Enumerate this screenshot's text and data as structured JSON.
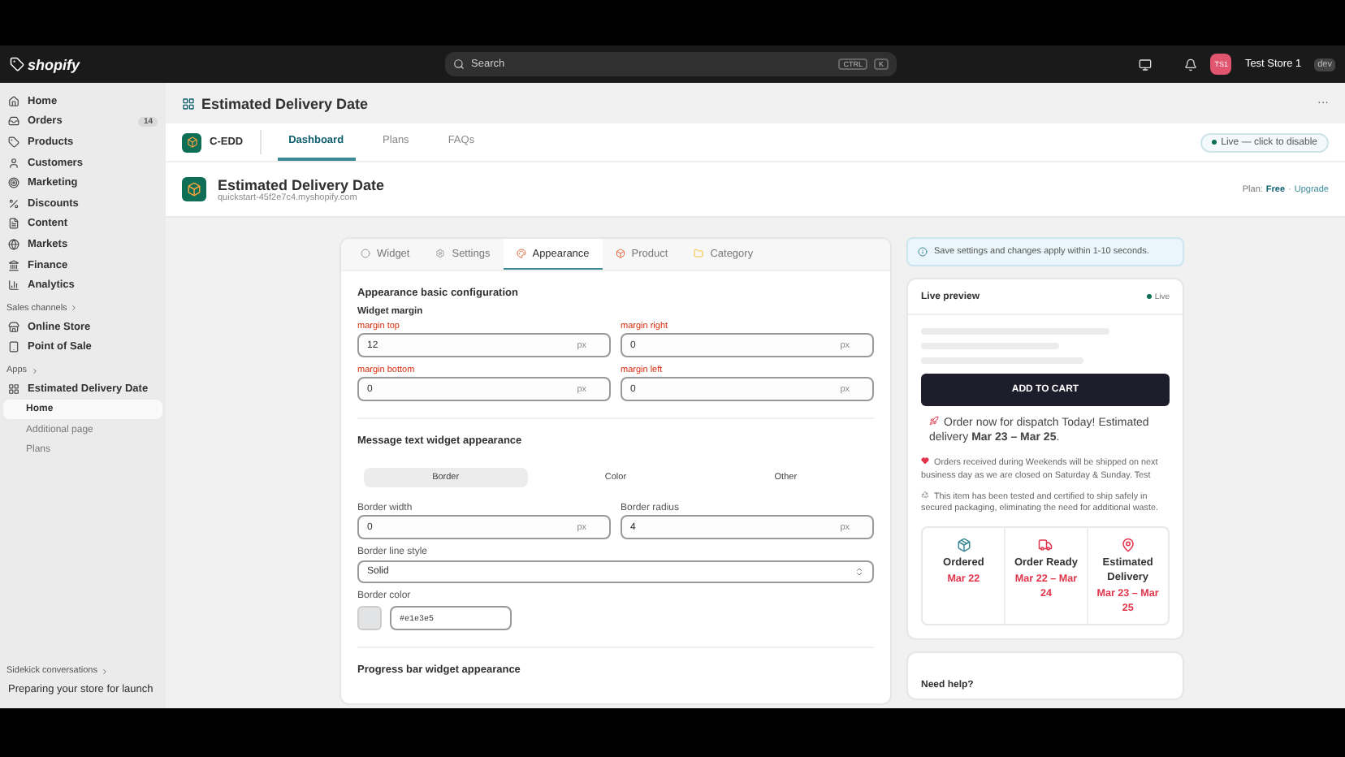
{
  "topbar": {
    "logo": "shopify",
    "search": {
      "placeholder": "Search",
      "keys": [
        "CTRL",
        "K"
      ]
    },
    "store": {
      "initials": "TS1",
      "name": "Test Store 1",
      "badge": "dev"
    }
  },
  "sidebar": {
    "items": [
      {
        "label": "Home",
        "selected": false
      },
      {
        "label": "Orders",
        "badge": "14",
        "selected": false
      },
      {
        "label": "Products",
        "selected": false
      },
      {
        "label": "Customers",
        "selected": false
      },
      {
        "label": "Marketing",
        "selected": false
      },
      {
        "label": "Discounts",
        "selected": false
      },
      {
        "label": "Content",
        "selected": false
      },
      {
        "label": "Markets",
        "selected": false
      },
      {
        "label": "Finance",
        "selected": false
      },
      {
        "label": "Analytics",
        "selected": false
      }
    ],
    "sales_channels": {
      "title": "Sales channels",
      "items": [
        {
          "label": "Online Store",
          "selected": false
        },
        {
          "label": "Point of Sale",
          "selected": false
        }
      ]
    },
    "apps": {
      "title": "Apps",
      "app": {
        "label": "Estimated Delivery Date",
        "children": [
          {
            "label": "Home",
            "selected": true
          },
          {
            "label": "Additional page",
            "selected": false
          },
          {
            "label": "Plans",
            "selected": false
          }
        ]
      }
    },
    "sidekick": {
      "title": "Sidekick conversations",
      "item": "Preparing your store for launch"
    }
  },
  "page": {
    "title": "Estimated Delivery Date",
    "more": "···"
  },
  "app_nav": {
    "name": "C-EDD",
    "tabs": [
      {
        "label": "Dashboard",
        "selected": true
      },
      {
        "label": "Plans",
        "selected": false
      },
      {
        "label": "FAQs",
        "selected": false
      }
    ],
    "status": "Live — click to disable"
  },
  "app_header": {
    "title": "Estimated Delivery Date",
    "domain": "quickstart-45f2e7c4.myshopify.com",
    "plan_label": "Plan:",
    "plan": "Free",
    "separator": "·",
    "upgrade": "Upgrade"
  },
  "settings_card": {
    "tabs": [
      {
        "label": "Widget",
        "selected": false
      },
      {
        "label": "Settings",
        "selected": false
      },
      {
        "label": "Appearance",
        "selected": true
      },
      {
        "label": "Product",
        "selected": false
      },
      {
        "label": "Category",
        "selected": false
      }
    ],
    "basic": {
      "title": "Appearance basic configuration",
      "subtitle": "Widget margin",
      "fields": [
        {
          "label": "margin top",
          "value": "12",
          "unit": "px"
        },
        {
          "label": "margin right",
          "value": "0",
          "unit": "px"
        },
        {
          "label": "margin bottom",
          "value": "0",
          "unit": "px"
        },
        {
          "label": "margin left",
          "value": "0",
          "unit": "px"
        }
      ]
    },
    "message": {
      "title": "Message text widget appearance",
      "segments": [
        {
          "label": "Border",
          "selected": true
        },
        {
          "label": "Color",
          "selected": false
        },
        {
          "label": "Other",
          "selected": false
        }
      ],
      "fields": [
        {
          "label": "Border width",
          "value": "0",
          "unit": "px"
        },
        {
          "label": "Border radius",
          "value": "4",
          "unit": "px"
        }
      ],
      "line_style": {
        "label": "Border line style",
        "value": "Solid"
      },
      "border_color": {
        "label": "Border color",
        "value": "#e1e3e5"
      }
    },
    "progress_title": "Progress bar widget appearance"
  },
  "notice": "Save settings and changes apply within 1-10 seconds.",
  "preview": {
    "title": "Live preview",
    "status": "Live",
    "button": "ADD TO CART",
    "message": "Order now for dispatch Today! Estimated delivery **Mar 23 – Mar 25**.",
    "notes": [
      "Orders received during Weekends will be shipped on next business day as we are closed on Saturday & Sunday. Test",
      "This item has been tested and certified to ship safely in secured packaging, eliminating the need for additional waste."
    ],
    "steps": [
      {
        "title": "Ordered",
        "date": "Mar 22"
      },
      {
        "title": "Order Ready",
        "date": "Mar 22 – Mar 24"
      },
      {
        "title": "Estimated Delivery",
        "date": "Mar 23 – Mar 25"
      }
    ]
  },
  "help": {
    "title": "Need help?"
  }
}
